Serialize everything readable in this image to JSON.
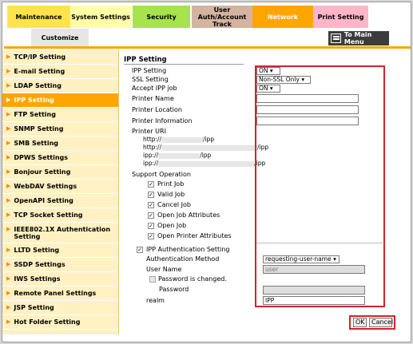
{
  "tabs": [
    {
      "label": "Maintenance",
      "color": "#ffe34d"
    },
    {
      "label": "System Settings",
      "color": "#ffffa8"
    },
    {
      "label": "Security",
      "color": "#a6e34d"
    },
    {
      "label": "User Auth/Account Track",
      "color": "#d4b4a0"
    },
    {
      "label": "Network",
      "color": "#ffa500"
    },
    {
      "label": "Print Setting",
      "color": "#ffb6c8"
    }
  ],
  "second_tab": "Customize",
  "to_main_menu": "To Main Menu",
  "accent_color": "#ffa500",
  "sidebar": {
    "items": [
      {
        "label": "TCP/IP Setting"
      },
      {
        "label": "E-mail Setting"
      },
      {
        "label": "LDAP Setting"
      },
      {
        "label": "IPP Setting",
        "active": true
      },
      {
        "label": "FTP Setting"
      },
      {
        "label": "SNMP Setting"
      },
      {
        "label": "SMB Setting"
      },
      {
        "label": "DPWS Settings"
      },
      {
        "label": "Bonjour Setting"
      },
      {
        "label": "WebDAV Settings"
      },
      {
        "label": "OpenAPI Setting"
      },
      {
        "label": "TCP Socket Setting"
      },
      {
        "label": "IEEE802.1X Authentication Setting"
      },
      {
        "label": "LLTD Setting"
      },
      {
        "label": "SSDP Settings"
      },
      {
        "label": "IWS Settings"
      },
      {
        "label": "Remote Panel Settings"
      },
      {
        "label": "JSP Setting"
      },
      {
        "label": "Hot Folder Setting"
      }
    ]
  },
  "form": {
    "title": "IPP Setting",
    "ipp_setting_label": "IPP Setting",
    "ipp_setting_value": "ON",
    "ssl_label": "SSL Setting",
    "ssl_value": "Non-SSL Only",
    "accept_label": "Accept IPP job",
    "accept_value": "ON",
    "printer_name_label": "Printer Name",
    "printer_location_label": "Printer Location",
    "printer_info_label": "Printer Information",
    "printer_uri_label": "Printer URI",
    "uris": [
      {
        "prefix": "http://",
        "suffix": "/ipp"
      },
      {
        "prefix": "http://",
        "suffix": "/ipp"
      },
      {
        "prefix": "ipp://",
        "suffix": "/ipp"
      },
      {
        "prefix": "ipp://",
        "suffix": "/ipp"
      }
    ],
    "support_label": "Support Operation",
    "operations": [
      {
        "label": "Print Job",
        "checked": true
      },
      {
        "label": "Valid Job",
        "checked": true
      },
      {
        "label": "Cancel Job",
        "checked": true
      },
      {
        "label": "Open Job Attributes",
        "checked": true
      },
      {
        "label": "Open Job",
        "checked": true
      },
      {
        "label": "Open Printer Attributes",
        "checked": true
      }
    ],
    "ipp_auth_label": "IPP Authentication Setting",
    "auth_method_label": "Authentication Method",
    "auth_method_value": "requesting-user-name",
    "user_name_label": "User Name",
    "user_name_value": "user",
    "password_changed_label": "Password is changed.",
    "password_label": "Password",
    "realm_label": "realm",
    "realm_value": "IPP"
  },
  "buttons": {
    "ok": "OK",
    "cancel": "Cancel"
  }
}
